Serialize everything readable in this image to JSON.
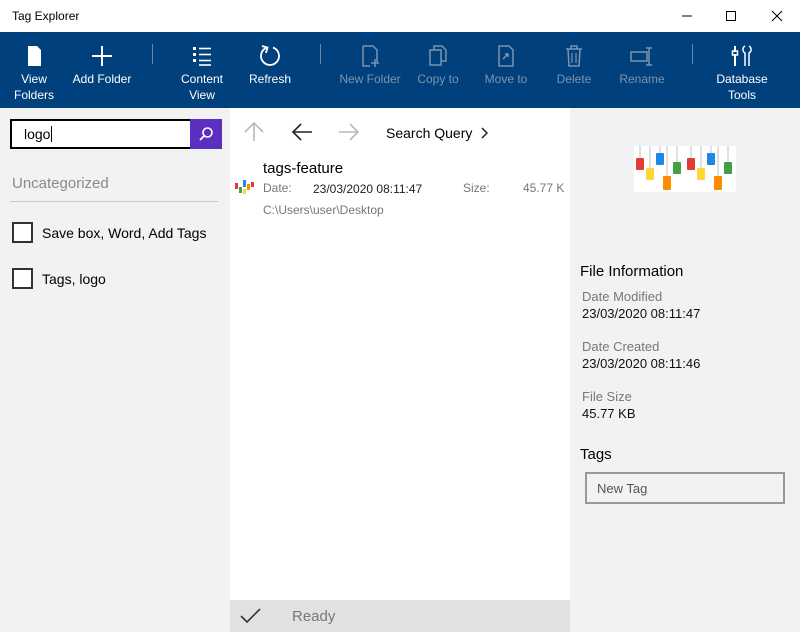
{
  "window": {
    "title": "Tag Explorer"
  },
  "toolbar": {
    "view_folders": "View Folders",
    "add_folder": "Add Folder",
    "content_view_1": "Content",
    "content_view_2": "View",
    "refresh": "Refresh",
    "new_folder": "New Folder",
    "copy_to": "Copy to",
    "move_to": "Move to",
    "delete": "Delete",
    "rename": "Rename",
    "database_tools_1": "Database",
    "database_tools_2": "Tools"
  },
  "sidebar": {
    "search_value": "logo",
    "category_title": "Uncategorized",
    "tag_groups": [
      {
        "label": "Save box, Word, Add Tags",
        "checked": false
      },
      {
        "label": "Tags, logo",
        "checked": false
      }
    ]
  },
  "content": {
    "breadcrumb": "Search Query",
    "file": {
      "name": "tags-feature",
      "date_label": "Date:",
      "date_value": "23/03/2020 08:11:47",
      "size_label": "Size:",
      "size_value": "45.77 K",
      "path": "C:\\Users\\user\\Desktop"
    },
    "status": "Ready"
  },
  "details": {
    "title": "File Information",
    "date_modified_label": "Date Modified",
    "date_modified_value": "23/03/2020 08:11:47",
    "date_created_label": "Date Created",
    "date_created_value": "23/03/2020 08:11:46",
    "file_size_label": "File Size",
    "file_size_value": "45.77 KB",
    "tags_title": "Tags",
    "new_tag_placeholder": "New Tag"
  },
  "colors": {
    "toolbar_bg": "#00407c",
    "search_button": "#5b2fc0",
    "panel_bg": "#f2f2f2",
    "status_bg": "#e1e1e1"
  }
}
